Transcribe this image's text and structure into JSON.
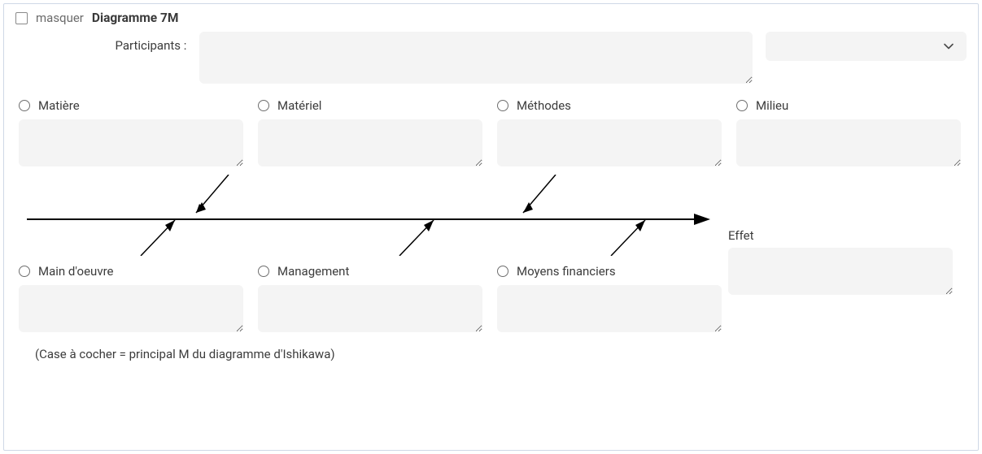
{
  "header": {
    "hide_label": "masquer",
    "title": "Diagramme 7M"
  },
  "participants": {
    "label": "Participants :",
    "value": ""
  },
  "select": {
    "selected": ""
  },
  "causes_top": [
    {
      "label": "Matière",
      "value": ""
    },
    {
      "label": "Matériel",
      "value": ""
    },
    {
      "label": "Méthodes",
      "value": ""
    },
    {
      "label": "Milieu",
      "value": ""
    }
  ],
  "causes_bottom": [
    {
      "label": "Main d'oeuvre",
      "value": ""
    },
    {
      "label": "Management",
      "value": ""
    },
    {
      "label": "Moyens financiers",
      "value": ""
    }
  ],
  "effect": {
    "label": "Effet",
    "value": ""
  },
  "footnote": "(Case à cocher = principal M du diagramme d'Ishikawa)"
}
